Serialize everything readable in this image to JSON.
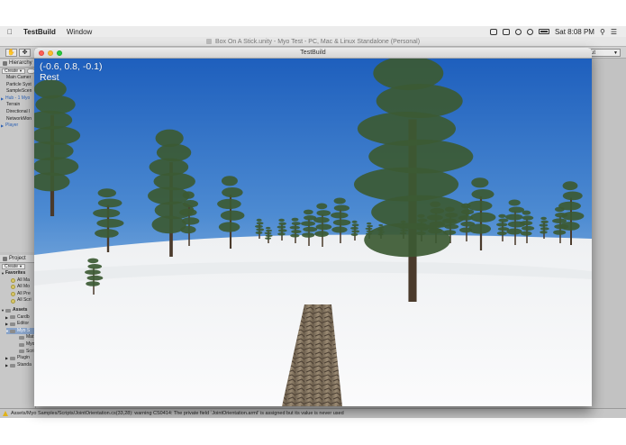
{
  "menubar": {
    "apple": "",
    "app_name": "TestBuild",
    "items": [
      "Window"
    ],
    "clock": "Sat 8:08 PM"
  },
  "editor": {
    "title": "Box On A Stick.unity - Myo Test - PC, Mac & Linux Standalone (Personal)",
    "layout_label": "ut"
  },
  "hierarchy": {
    "tab": "Hierarchy",
    "create": "Create",
    "items": [
      {
        "label": "Main Camer"
      },
      {
        "label": "Particle Syst"
      },
      {
        "label": "SampleScen"
      },
      {
        "label": "Hub - 1 Myo"
      },
      {
        "label": "Terrain"
      },
      {
        "label": "Directional l"
      },
      {
        "label": "NetworkMon"
      },
      {
        "label": "Player"
      }
    ]
  },
  "project": {
    "tab": "Project",
    "create": "Create",
    "favorites_label": "Favorites",
    "favorites": [
      "All Ma",
      "All Mo",
      "All Pre",
      "All Scri"
    ],
    "assets_label": "Assets",
    "assets": [
      "Cardb",
      "Editor",
      "Myo S",
      "Mat",
      "Myo",
      "Scri",
      "Plugin",
      "Standa"
    ]
  },
  "status": {
    "message": "Assets/Myo Samples/Scripts/JointOrientation.cs(33,28): warning CS0414: The private field `JointOrientation.armI' is assigned but its value is never used"
  },
  "game": {
    "window_title": "TestBuild",
    "orientation_readout": "(-0.6, 0.8, -0.1)",
    "pose_label": "Rest"
  },
  "colors": {
    "sky_top": "#1f63bf",
    "sky_horizon": "#b8d4ea",
    "snow": "#f5f6f7",
    "tree_foliage": "#3c5a33",
    "tree_trunk": "#4a3a2b",
    "stick": "#8a7a66"
  }
}
